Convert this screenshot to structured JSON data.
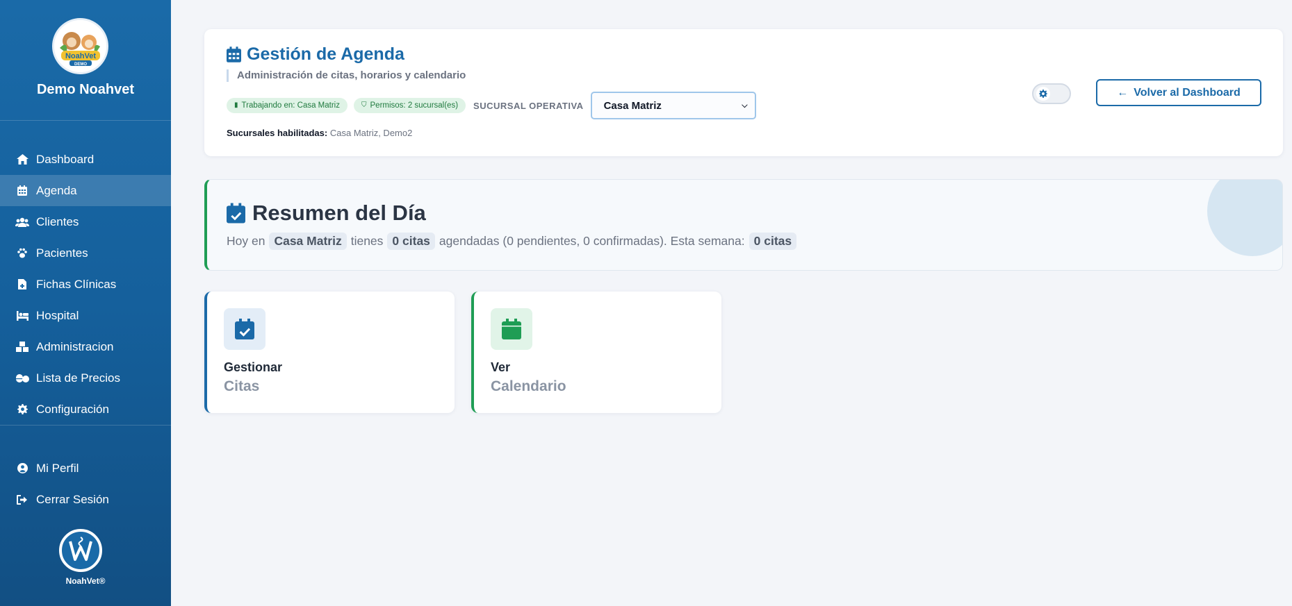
{
  "sidebar": {
    "brand_name": "Demo Noahvet",
    "logo_text": "NoahVet",
    "logo_sub": "DEMO",
    "items": [
      {
        "label": "Dashboard",
        "icon": "home-icon"
      },
      {
        "label": "Agenda",
        "icon": "calendar-icon"
      },
      {
        "label": "Clientes",
        "icon": "users-icon"
      },
      {
        "label": "Pacientes",
        "icon": "paw-icon"
      },
      {
        "label": "Fichas Clínicas",
        "icon": "file-medical-icon"
      },
      {
        "label": "Hospital",
        "icon": "hospital-bed-icon"
      },
      {
        "label": "Administracion",
        "icon": "boxes-icon"
      },
      {
        "label": "Lista de Precios",
        "icon": "pills-icon"
      },
      {
        "label": "Configuración",
        "icon": "gear-icon"
      }
    ],
    "active_item": "Agenda",
    "secondary_items": [
      {
        "label": "Mi Perfil",
        "icon": "user-circle-icon"
      },
      {
        "label": "Cerrar Sesión",
        "icon": "sign-out-icon"
      }
    ],
    "footer_label": "NoahVet®"
  },
  "header": {
    "title": "Gestión de Agenda",
    "subtitle": "Administración de citas, horarios y calendario",
    "badge_working": "Trabajando en: Casa Matriz",
    "badge_permissions": "Permisos: 2 sucursal(es)",
    "branch_label": "SUCURSAL OPERATIVA",
    "branch_selected": "Casa Matriz",
    "enabled_label": "Sucursales habilitadas:",
    "enabled_value": "Casa Matriz, Demo2",
    "back_button": "Volver al Dashboard"
  },
  "summary": {
    "title": "Resumen del Día",
    "text_1": "Hoy en",
    "branch": "Casa Matriz",
    "text_2": "tienes",
    "today_count": "0 citas",
    "text_3": "agendadas (0 pendientes, 0 confirmadas). Esta semana:",
    "week_count": "0 citas"
  },
  "actions": [
    {
      "title": "Gestionar",
      "subtitle": "Citas",
      "icon": "calendar-check-icon",
      "color": "#1b6aa8"
    },
    {
      "title": "Ver",
      "subtitle": "Calendario",
      "icon": "calendar-icon",
      "color": "#1f9d55"
    }
  ],
  "colors": {
    "sidebar_top": "#1a6aa8",
    "sidebar_bottom": "#124f83",
    "primary": "#1b6aa8",
    "success": "#1f9d55",
    "background": "#f3f5f9"
  }
}
